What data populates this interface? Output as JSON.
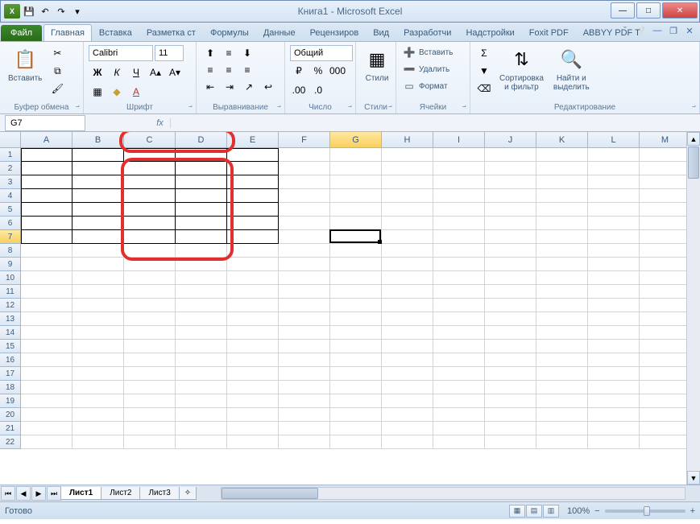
{
  "title": "Книга1 - Microsoft Excel",
  "qat": {
    "save": "💾",
    "undo": "↶",
    "redo": "↷"
  },
  "tabs": {
    "file": "Файл",
    "items": [
      "Главная",
      "Вставка",
      "Разметка ст",
      "Формулы",
      "Данные",
      "Рецензиров",
      "Вид",
      "Разработчи",
      "Надстройки",
      "Foxit PDF",
      "ABBYY PDF T"
    ],
    "active": 0
  },
  "ribbon": {
    "clipboard": {
      "label": "Буфер обмена",
      "paste": "Вставить"
    },
    "font": {
      "label": "Шрифт",
      "name": "Calibri",
      "size": "11"
    },
    "align": {
      "label": "Выравнивание"
    },
    "number": {
      "label": "Число",
      "format": "Общий"
    },
    "styles": {
      "label": "Стили",
      "btn": "Стили"
    },
    "cells": {
      "label": "Ячейки",
      "insert": "Вставить",
      "delete": "Удалить",
      "format": "Формат"
    },
    "editing": {
      "label": "Редактирование",
      "sort": "Сортировка\nи фильтр",
      "find": "Найти и\nвыделить"
    }
  },
  "formula": {
    "cell_ref": "G7",
    "fx": "fx"
  },
  "grid": {
    "cols": [
      "A",
      "B",
      "C",
      "D",
      "E",
      "F",
      "G",
      "H",
      "I",
      "J",
      "K",
      "L",
      "M"
    ],
    "rows": [
      1,
      2,
      3,
      4,
      5,
      6,
      7,
      8,
      9,
      10,
      11,
      12,
      13,
      14,
      15,
      16,
      17,
      18,
      19,
      20,
      21,
      22
    ],
    "active_col": "G",
    "active_row": 7,
    "bordered_range": {
      "cols": [
        "A",
        "B",
        "C",
        "D",
        "E"
      ],
      "rows": [
        1,
        2,
        3,
        4,
        5,
        6,
        7
      ]
    }
  },
  "sheets": {
    "items": [
      "Лист1",
      "Лист2",
      "Лист3"
    ],
    "active": 0
  },
  "status": {
    "ready": "Готово",
    "zoom": "100%"
  }
}
